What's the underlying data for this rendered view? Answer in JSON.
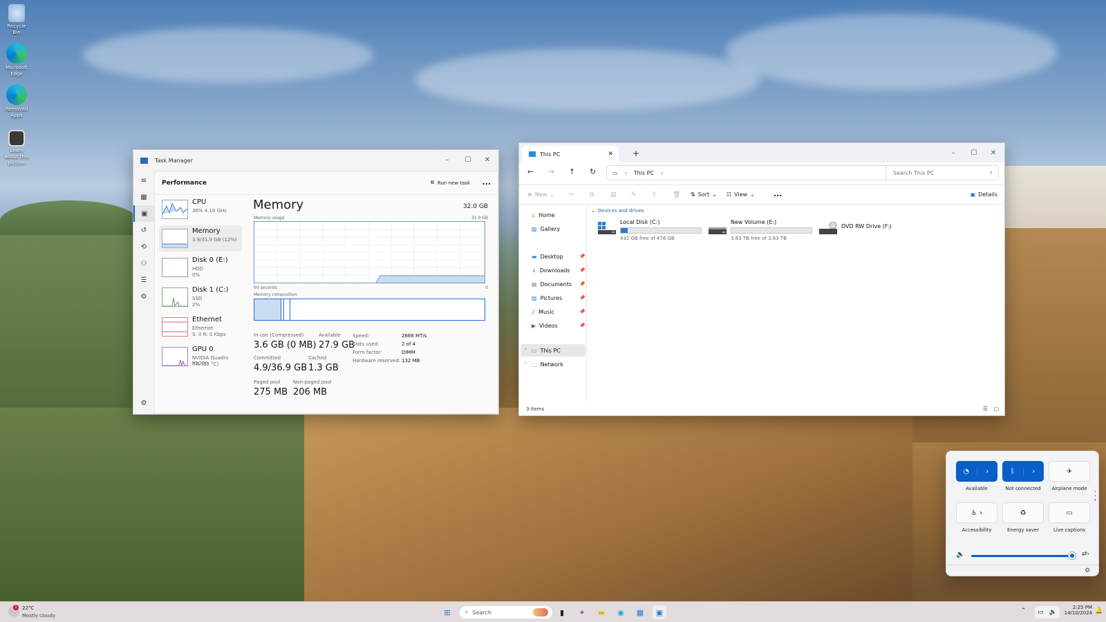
{
  "desktop": {
    "icons": [
      {
        "label": "Recycle Bin"
      },
      {
        "label": "Microsoft Edge"
      },
      {
        "label": "Removed Apps"
      },
      {
        "label": "Learn about this picture"
      }
    ]
  },
  "task_manager": {
    "title": "Task Manager",
    "header": "Performance",
    "run_new_task": "Run new task",
    "more": "...",
    "items": [
      {
        "name": "CPU",
        "sub1": "36%  4.19 GHz",
        "sub2": ""
      },
      {
        "name": "Memory",
        "sub1": "3.9/31.9 GB (12%)",
        "sub2": ""
      },
      {
        "name": "Disk 0 (E:)",
        "sub1": "HDD",
        "sub2": "0%"
      },
      {
        "name": "Disk 1 (C:)",
        "sub1": "SSD",
        "sub2": "2%"
      },
      {
        "name": "Ethernet",
        "sub1": "Ethernet",
        "sub2": "S: 0  R: 0 Kbps"
      },
      {
        "name": "GPU 0",
        "sub1": "NVIDIA Quadro P2000",
        "sub2": "0% (33 °C)"
      }
    ],
    "memory": {
      "title": "Memory",
      "total": "32.0 GB",
      "usage_label": "Memory usage",
      "usage_max": "31.9 GB",
      "x_left": "60 seconds",
      "x_right": "0",
      "composition_label": "Memory composition",
      "in_use_label": "In use (Compressed)",
      "in_use_value": "3.6 GB (0 MB)",
      "available_label": "Available",
      "available_value": "27.9 GB",
      "committed_label": "Committed",
      "committed_value": "4.9/36.9 GB",
      "cached_label": "Cached",
      "cached_value": "1.3 GB",
      "paged_label": "Paged pool",
      "paged_value": "275 MB",
      "nonpaged_label": "Non-paged pool",
      "nonpaged_value": "206 MB",
      "speed_label": "Speed:",
      "speed_value": "2666 MT/s",
      "slots_label": "Slots used:",
      "slots_value": "2 of 4",
      "form_label": "Form factor:",
      "form_value": "DIMM",
      "reserved_label": "Hardware reserved:",
      "reserved_value": "132 MB"
    }
  },
  "explorer": {
    "tab_title": "This PC",
    "address": "This PC",
    "search_placeholder": "Search This PC",
    "toolbar": {
      "new": "New",
      "sort": "Sort",
      "view": "View",
      "more": "...",
      "details": "Details"
    },
    "nav": {
      "home": "Home",
      "gallery": "Gallery",
      "desktop": "Desktop",
      "downloads": "Downloads",
      "documents": "Documents",
      "pictures": "Pictures",
      "music": "Music",
      "videos": "Videos",
      "thispc": "This PC",
      "network": "Network"
    },
    "section": "Devices and drives",
    "drives": [
      {
        "name": "Local Disk (C:)",
        "free": "432 GB free of 476 GB",
        "used_fraction": 0.09
      },
      {
        "name": "New Volume (E:)",
        "free": "3.63 TB free of 3.63 TB",
        "used_fraction": 0.0
      },
      {
        "name": "DVD RW Drive (F:)",
        "free": ""
      }
    ],
    "dvd_badge": "DVD",
    "status": "3 items"
  },
  "quick_settings": {
    "wifi": "Available",
    "bluetooth": "Not connected",
    "airplane": "Airplane mode",
    "accessibility": "Accessibility",
    "energy": "Energy saver",
    "captions": "Live captions",
    "volume_level": 0.97
  },
  "taskbar": {
    "weather_temp": "22°C",
    "weather_desc": "Mostly cloudy",
    "weather_badge": "1",
    "search": "Search",
    "time": "2:25 PM",
    "date": "14/10/2024"
  },
  "colors": {
    "accent": "#0a5ec8",
    "memory_line": "#6c9bd2",
    "memory_fill": "#c9dcf2"
  }
}
